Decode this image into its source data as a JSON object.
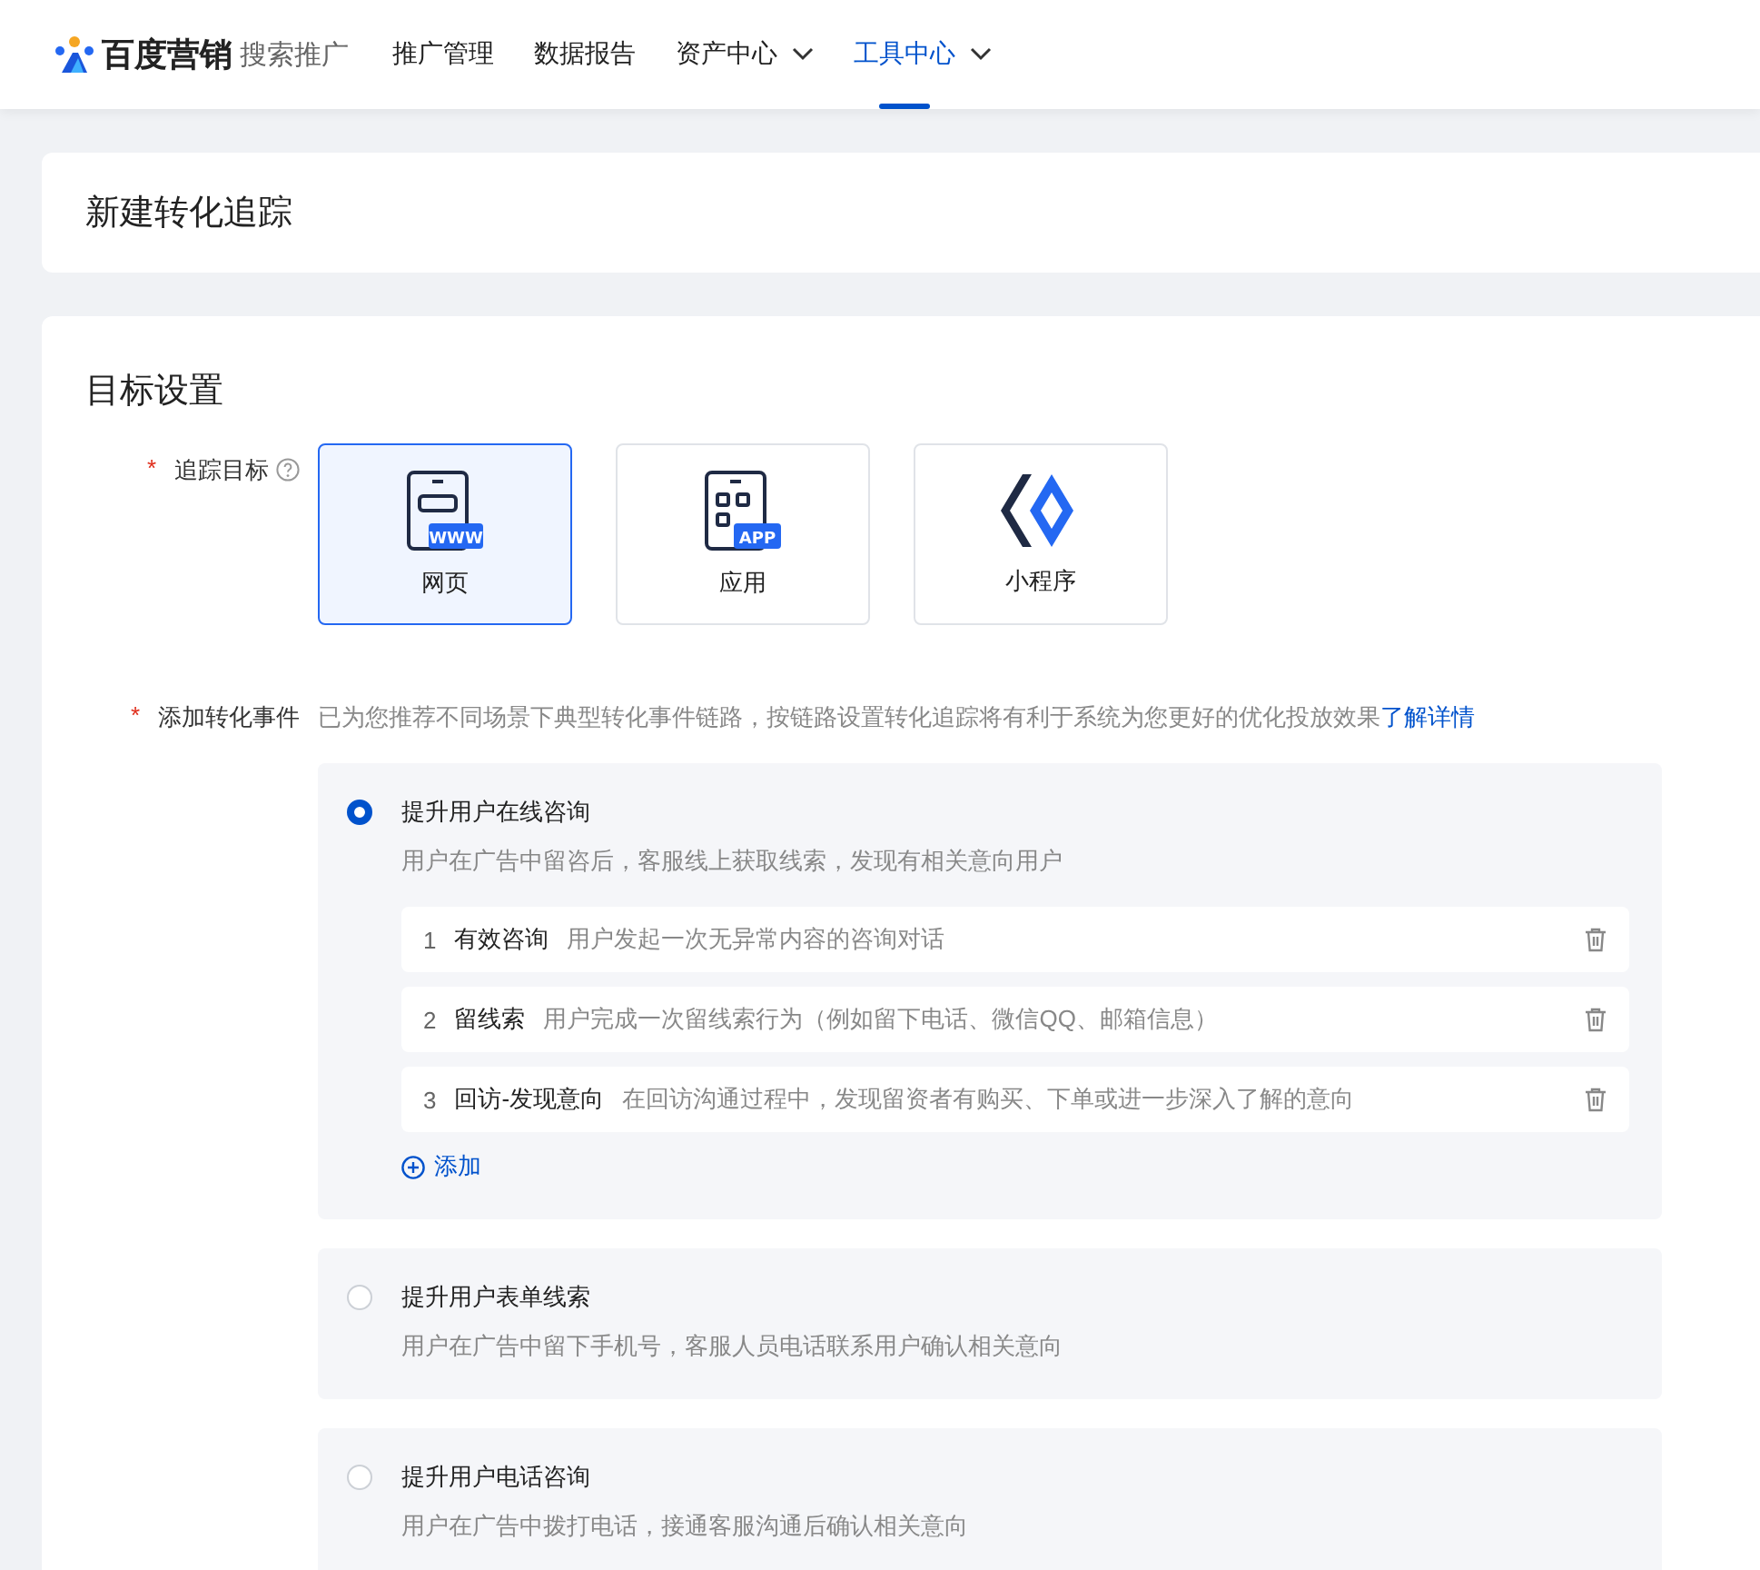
{
  "header": {
    "logo": {
      "brand": "百度营销",
      "product": "搜索推广"
    },
    "nav": [
      {
        "label": "推广管理",
        "selected": false,
        "dropdown": false
      },
      {
        "label": "数据报告",
        "selected": false,
        "dropdown": false
      },
      {
        "label": "资产中心",
        "selected": false,
        "dropdown": true
      },
      {
        "label": "工具中心",
        "selected": true,
        "dropdown": true
      }
    ]
  },
  "page_title": "新建转化追踪",
  "section": {
    "title": "目标设置",
    "track_target": {
      "label": "追踪目标",
      "required_mark": "*",
      "options": [
        {
          "kind": "web",
          "label": "网页",
          "badge": "WWW",
          "selected": true
        },
        {
          "kind": "app",
          "label": "应用",
          "badge": "APP",
          "selected": false
        },
        {
          "kind": "miniprogram",
          "label": "小程序",
          "selected": false
        }
      ]
    },
    "events": {
      "label": "添加转化事件",
      "required_mark": "*",
      "hint": "已为您推荐不同场景下典型转化事件链路，按链路设置转化追踪将有利于系统为您更好的优化投放效果",
      "link": "了解详情",
      "scenarios": [
        {
          "title": "提升用户在线咨询",
          "desc": "用户在广告中留咨后，客服线上获取线索，发现有相关意向用户",
          "selected": true,
          "steps": [
            {
              "index": "1",
              "name": "有效咨询",
              "desc": "用户发起一次无异常内容的咨询对话"
            },
            {
              "index": "2",
              "name": "留线索",
              "desc": "用户完成一次留线索行为（例如留下电话、微信QQ、邮箱信息）"
            },
            {
              "index": "3",
              "name": "回访-发现意向",
              "desc": "在回访沟通过程中，发现留资者有购买、下单或进一步深入了解的意向"
            }
          ],
          "add_label": "添加"
        },
        {
          "title": "提升用户表单线索",
          "desc": "用户在广告中留下手机号，客服人员电话联系用户确认相关意向",
          "selected": false
        },
        {
          "title": "提升用户电话咨询",
          "desc": "用户在广告中拨打电话，接通客服沟通后确认相关意向",
          "selected": false
        }
      ]
    }
  }
}
